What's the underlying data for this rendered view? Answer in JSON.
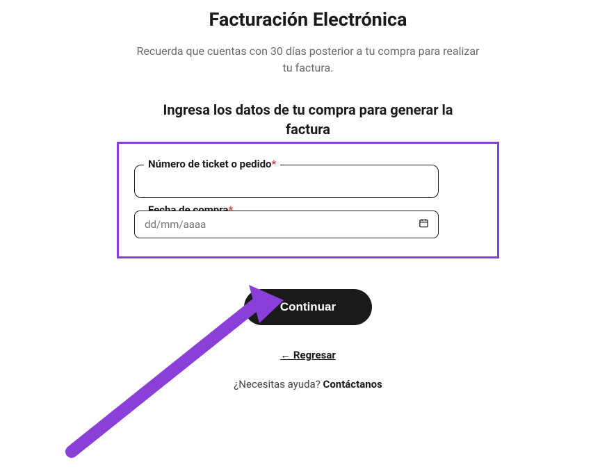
{
  "header": {
    "title": "Facturación Electrónica",
    "subtitle": "Recuerda que cuentas con 30 días posterior a tu compra para realizar tu factura."
  },
  "form": {
    "heading": "Ingresa los datos de tu compra para generar la factura",
    "ticket": {
      "label": "Número de ticket o pedido",
      "value": ""
    },
    "date": {
      "label": "Fecha de compra",
      "placeholder": "dd/mm/aaaa",
      "value": ""
    },
    "required_mark": "*"
  },
  "actions": {
    "continue_label": "Continuar",
    "back_label": "← Regresar"
  },
  "help": {
    "question": "¿Necesitas ayuda? ",
    "contact_label": "Contáctanos"
  },
  "annotation": {
    "highlight_color": "#8b3fd9",
    "arrow_color": "#8b3fd9"
  }
}
